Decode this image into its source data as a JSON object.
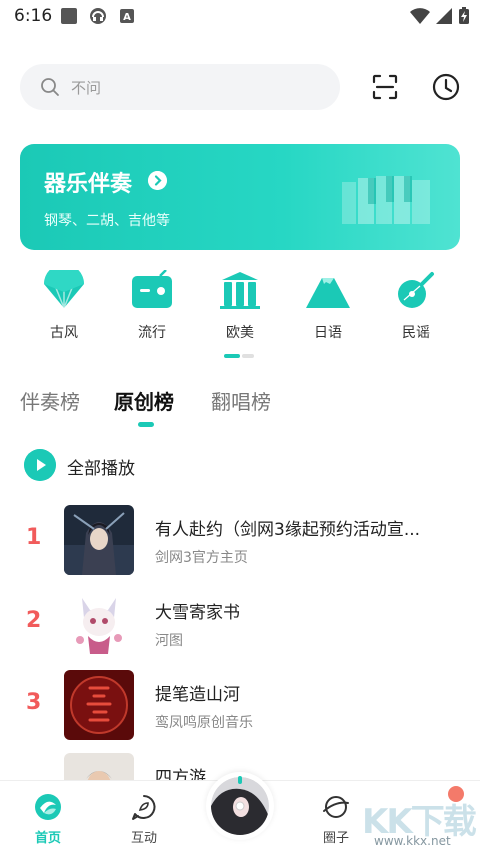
{
  "status_bar": {
    "time": "6:16",
    "icons": [
      "gallery-icon",
      "headset-icon",
      "keyboard-a-icon"
    ],
    "right_icons": [
      "wifi-icon",
      "signal-icon",
      "battery-charging-icon"
    ]
  },
  "search": {
    "placeholder": "不问"
  },
  "top_actions": [
    "scan-icon",
    "history-clock-icon"
  ],
  "banner": {
    "title": "器乐伴奏",
    "subtitle": "钢琴、二胡、吉他等"
  },
  "categories": [
    {
      "label": "古风",
      "icon": "fan-icon"
    },
    {
      "label": "流行",
      "icon": "radio-icon"
    },
    {
      "label": "欧美",
      "icon": "columns-icon"
    },
    {
      "label": "日语",
      "icon": "mountain-icon"
    },
    {
      "label": "民谣",
      "icon": "guitar-icon"
    }
  ],
  "tabs": [
    "伴奏榜",
    "原创榜",
    "翻唱榜"
  ],
  "active_tab": "原创榜",
  "play_all_label": "全部播放",
  "songs": [
    {
      "rank": "1",
      "title": "有人赴约（剑网3缘起预约活动宣...",
      "artist": "剑网3官方主页"
    },
    {
      "rank": "2",
      "title": "大雪寄家书",
      "artist": "河图"
    },
    {
      "rank": "3",
      "title": "提笔造山河",
      "artist": "鸾凤鸣原创音乐"
    },
    {
      "rank": "",
      "title": "四方游",
      "artist": ""
    }
  ],
  "bottom_nav": [
    {
      "label": "首页",
      "icon": "home-icon",
      "active": true
    },
    {
      "label": "互动",
      "icon": "chat-bubble-icon",
      "active": false
    },
    {
      "label": "",
      "icon": "now-playing-disc",
      "active": false
    },
    {
      "label": "圈子",
      "icon": "planet-icon",
      "active": false
    }
  ],
  "watermark": {
    "text": "KK下载",
    "url": "www.kkx.net"
  },
  "colors": {
    "accent": "#1bc9b6",
    "rank": "#f15b5b",
    "search_bg": "#f3f4f6"
  }
}
